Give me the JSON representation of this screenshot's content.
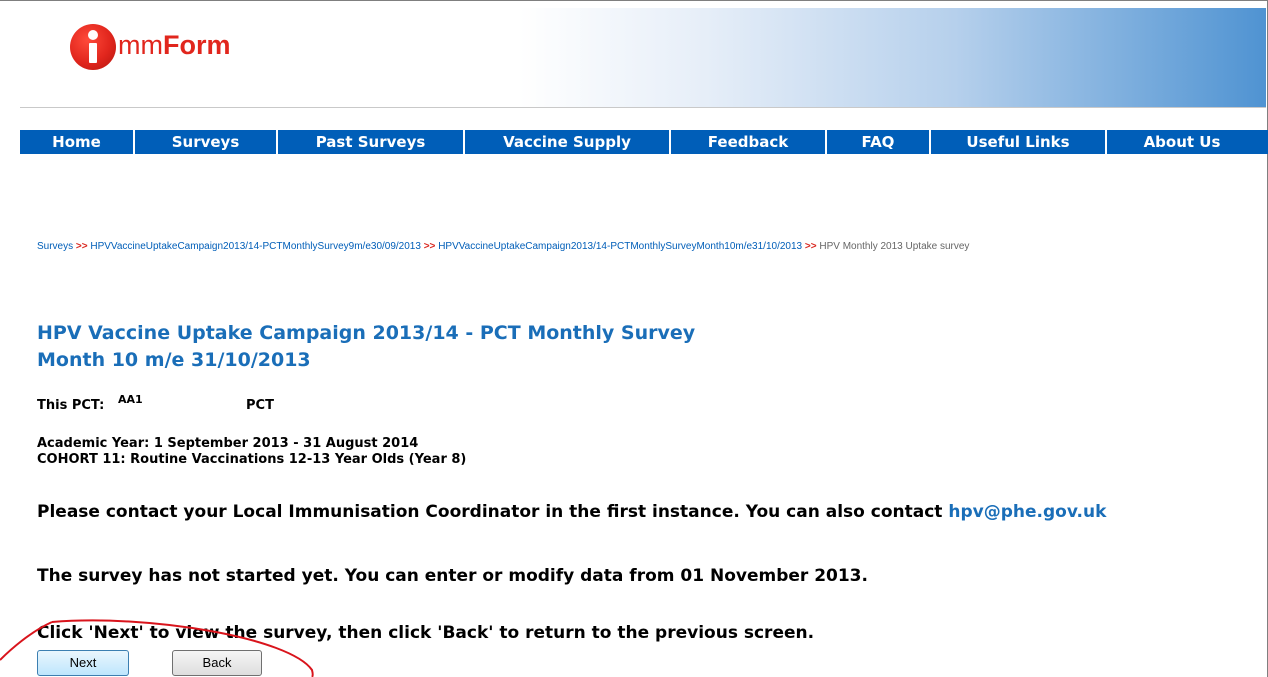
{
  "logo": {
    "prefix": "mm",
    "bold": "Form",
    "icon": "i-letter-circle-icon"
  },
  "nav": [
    {
      "label": "Home"
    },
    {
      "label": "Surveys"
    },
    {
      "label": "Past Surveys"
    },
    {
      "label": "Vaccine Supply"
    },
    {
      "label": "Feedback"
    },
    {
      "label": "FAQ"
    },
    {
      "label": "Useful Links"
    },
    {
      "label": "About Us"
    }
  ],
  "breadcrumb": {
    "items": [
      "Surveys",
      "HPVVaccineUptakeCampaign2013/14-PCTMonthlySurvey9m/e30/09/2013",
      "HPVVaccineUptakeCampaign2013/14-PCTMonthlySurveyMonth10m/e31/10/2013"
    ],
    "current": "HPV Monthly 2013 Uptake survey",
    "separator": ">>"
  },
  "title": {
    "line1": "HPV Vaccine Uptake Campaign 2013/14 - PCT Monthly Survey",
    "line2": "Month 10 m/e 31/10/2013"
  },
  "pct": {
    "label": "This PCT:",
    "code": "AA1",
    "suffix": "PCT"
  },
  "academic_year": "Academic Year: 1 September 2013 - 31 August 2014",
  "cohort": "COHORT 11: Routine Vaccinations 12-13 Year Olds (Year 8)",
  "contact": {
    "text": "Please contact your Local Immunisation Coordinator in the first instance. You can also contact ",
    "email": "hpv@phe.gov.uk"
  },
  "status_message": "The survey has not started yet. You can enter or modify data from 01 November 2013.",
  "instruction": "Click 'Next' to view the survey, then click 'Back' to return to the previous screen.",
  "buttons": {
    "next": "Next",
    "back": "Back"
  },
  "colors": {
    "nav_bg": "#005eb8",
    "title": "#1a6eb8",
    "brand_red": "#e1261d",
    "annotation": "#d9141c"
  }
}
